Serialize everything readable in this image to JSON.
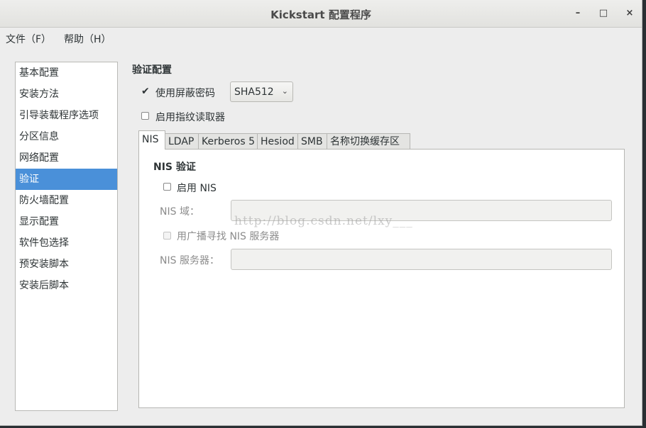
{
  "window": {
    "title": "Kickstart 配置程序"
  },
  "window_controls": {
    "minimize": "–",
    "maximize": "□",
    "close": "×"
  },
  "menubar": {
    "file": "文件（F）",
    "help": "帮助（H）"
  },
  "sidebar": {
    "items": [
      {
        "label": "基本配置"
      },
      {
        "label": "安装方法"
      },
      {
        "label": "引导装载程序选项"
      },
      {
        "label": "分区信息"
      },
      {
        "label": "网络配置"
      },
      {
        "label": "验证",
        "selected": true
      },
      {
        "label": "防火墙配置"
      },
      {
        "label": "显示配置"
      },
      {
        "label": "软件包选择"
      },
      {
        "label": "预安装脚本"
      },
      {
        "label": "安装后脚本"
      }
    ]
  },
  "auth": {
    "section_title": "验证配置",
    "shadow_password": {
      "label": "使用屏蔽密码",
      "checked": true
    },
    "hash_algorithm": {
      "value": "SHA512"
    },
    "fingerprint_reader": {
      "label": "启用指纹读取器",
      "checked": false
    }
  },
  "tabs": [
    {
      "label": "NIS",
      "active": true
    },
    {
      "label": "LDAP"
    },
    {
      "label": "Kerberos 5"
    },
    {
      "label": "Hesiod"
    },
    {
      "label": "SMB"
    },
    {
      "label": "名称切换缓存区"
    }
  ],
  "nis": {
    "title": "NIS 验证",
    "enable": {
      "label": "启用  NIS",
      "checked": false
    },
    "domain": {
      "label": "NIS 域：",
      "value": ""
    },
    "broadcast": {
      "label": "用广播寻找  NIS 服务器",
      "checked": false,
      "disabled": true
    },
    "server": {
      "label": "NIS 服务器：",
      "value": ""
    }
  },
  "watermark": "http://blog.csdn.net/lxy___",
  "colors": {
    "selection": "#4a90d9",
    "window_bg": "#ededed",
    "panel_bg": "#ffffff"
  }
}
